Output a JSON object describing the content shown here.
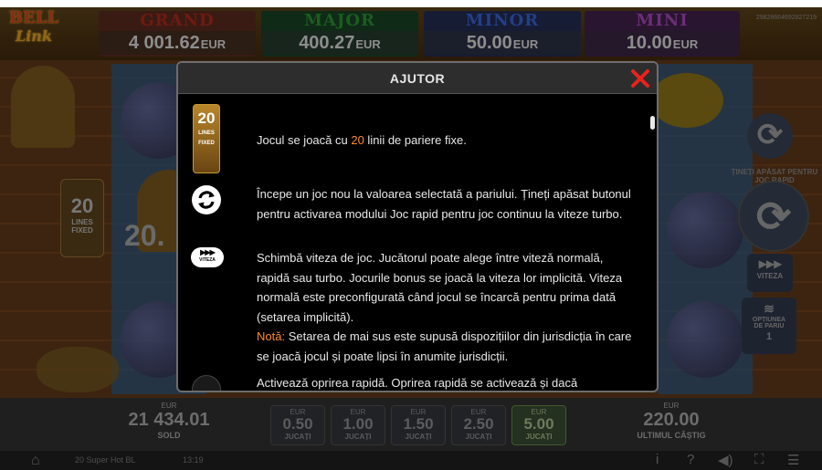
{
  "game": {
    "logo_top": "BELL",
    "logo_bottom": "Link",
    "session_id": "29828664692827219"
  },
  "jackpots": [
    {
      "name": "GRAND",
      "amount": "4 001.62",
      "currency": "EUR",
      "color": "#6f1a10"
    },
    {
      "name": "MAJOR",
      "amount": "400.27",
      "currency": "EUR",
      "color": "#1b5d1f"
    },
    {
      "name": "MINOR",
      "amount": "50.00",
      "currency": "EUR",
      "color": "#243e88"
    },
    {
      "name": "MINI",
      "amount": "10.00",
      "currency": "EUR",
      "color": "#6a2f78"
    }
  ],
  "reels_bg": {
    "lines_number": "20",
    "lines_label_1": "LINES",
    "lines_label_2": "FIXED",
    "big_number": "20."
  },
  "side": {
    "turbo_arc_text": "ȚINEȚI APĂSAT PENTRU JOC RAPID",
    "speed_label": "VITEZA",
    "bet_options_label_1": "OPȚIUNEA",
    "bet_options_label_2": "DE PARIU",
    "bet_options_value": "1"
  },
  "bottom": {
    "balance": {
      "currency": "EUR",
      "value": "21 434.01",
      "label": "SOLD"
    },
    "bets": [
      {
        "currency": "EUR",
        "value": "0.50",
        "label": "JUCAȚI"
      },
      {
        "currency": "EUR",
        "value": "1.00",
        "label": "JUCAȚI"
      },
      {
        "currency": "EUR",
        "value": "1.50",
        "label": "JUCAȚI"
      },
      {
        "currency": "EUR",
        "value": "2.50",
        "label": "JUCAȚI"
      },
      {
        "currency": "EUR",
        "value": "5.00",
        "label": "JUCAȚI"
      }
    ],
    "last_win": {
      "currency": "EUR",
      "value": "220.00",
      "label": "ULTIMUL CÂȘTIG"
    }
  },
  "status": {
    "game_name": "20 Super Hot BL",
    "time": "13:19",
    "info_icon": "i",
    "help_icon": "?"
  },
  "help_modal": {
    "title": "AJUTOR",
    "close_icon": "close-icon",
    "lines_badge_number": "20",
    "lines_badge_text_1": "LINES",
    "lines_badge_text_2": "FIXED",
    "speed_pill_label": "VITEZA",
    "row1": {
      "pre": "Jocul se joacă cu ",
      "highlight": "20",
      "post": " linii de pariere fixe."
    },
    "row2": "Începe un joc nou la valoarea selectată a pariului. Țineți apăsat butonul pentru activarea modului Joc rapid pentru joc continuu la viteze turbo.",
    "row3": "Schimbă viteza de joc. Jucătorul poate alege între viteză normală, rapidă sau turbo. Jocurile bonus se joacă la viteza lor implicită. Viteza normală este preconfigurată când jocul se încarcă pentru prima dată (setarea implicită).",
    "row3_note_label": "Notă:",
    "row3_note": " Setarea de mai sus este supusă dispozițiilor din jurisdicția în care se joacă jocul și poate lipsi în anumite jurisdicții.",
    "row4": "Activează oprirea rapidă. Oprirea rapidă se activează și dacă"
  },
  "colors": {
    "accent_orange": "#ff8a1f",
    "close_red": "#e8231d",
    "badge_gold": "#b8862a"
  }
}
